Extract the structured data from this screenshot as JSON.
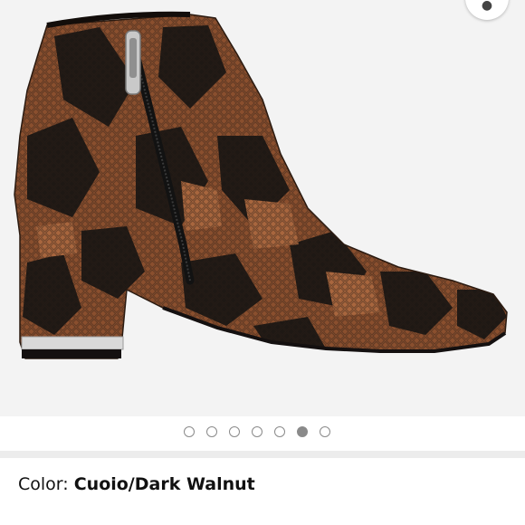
{
  "product": {
    "image_alt": "Snakeskin print block-heel ankle boot with side zipper",
    "carousel": {
      "total": 7,
      "active_index": 5
    },
    "color_label": "Color:",
    "color_value": "Cuoio/Dark Walnut"
  },
  "colors": {
    "image_background": "#f3f3f3",
    "leather_base": "#8a4f2e",
    "leather_dark": "#1e1814",
    "dot_border": "#8a8a8a"
  },
  "icons": {
    "corner": "share-icon"
  }
}
